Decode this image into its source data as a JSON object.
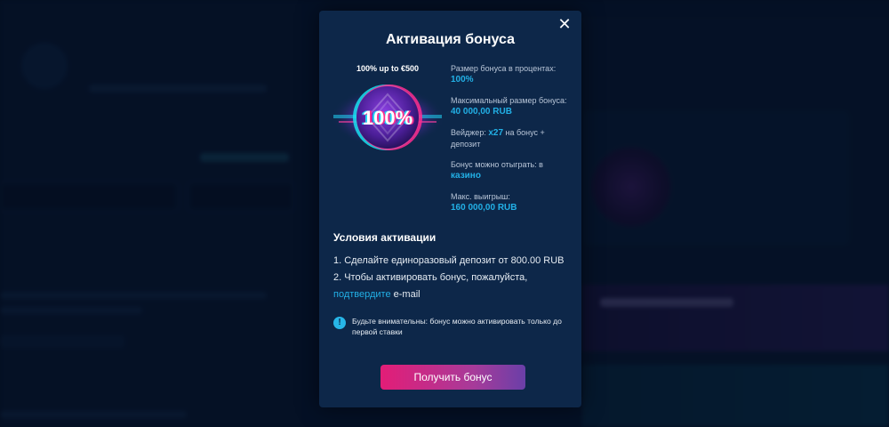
{
  "modal": {
    "title": "Активация бонуса",
    "close_icon": "close-icon",
    "bonus_caption": "100% up to €500",
    "bonus_badge": "100%",
    "details": [
      {
        "label": "Размер бонуса в процентах:",
        "value": "100%"
      },
      {
        "label": "Максимальный размер бонуса:",
        "value": "40 000,00 RUB"
      },
      {
        "label": "Вейджер:",
        "value": "x27",
        "suffix": "на бонус + депозит"
      },
      {
        "label": "Бонус можно отыграть: в",
        "value": "казино"
      },
      {
        "label": "Макс. выигрыш:",
        "value": "160 000,00 RUB"
      }
    ],
    "conditions_title": "Условия активации",
    "conditions": {
      "item1": "1. Сделайте единоразовый депозит от 800.00 RUB",
      "item2_prefix": "2. Чтобы активировать бонус, пожалуйста,",
      "item2_link": "подтвердите",
      "item2_suffix": " e-mail"
    },
    "note": "Будьте внимательны: бонус можно активировать только до первой ставки",
    "cta_label": "Получить бонус"
  },
  "colors": {
    "accent": "#22b0e6",
    "modal_bg": "#0d2749",
    "cta_start": "#e31d77",
    "cta_end": "#6a3fa8"
  }
}
